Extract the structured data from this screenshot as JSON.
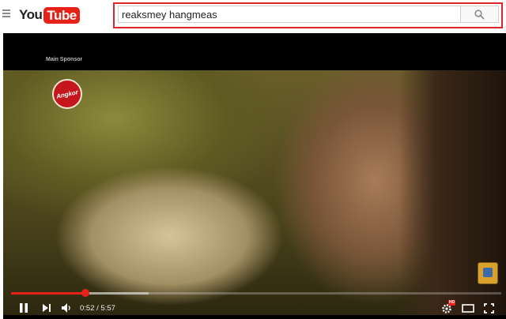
{
  "header": {
    "logo_you": "You",
    "logo_tube": "Tube",
    "search": {
      "value": "reaksmey hangmeas",
      "placeholder": ""
    }
  },
  "video": {
    "sponsor_label": "Main Sponsor",
    "logo_text": "Angkor",
    "progress": {
      "played_fraction": 0.152,
      "buffered_fraction": 0.28
    },
    "time": {
      "current": "0:52",
      "separator": " / ",
      "duration": "5:57"
    },
    "icons": {
      "play_pause": "pause-icon",
      "next": "next-icon",
      "volume": "volume-icon",
      "settings": "settings-icon",
      "theater": "theater-mode-icon",
      "fullscreen": "fullscreen-icon"
    },
    "hd_badge": "HD"
  },
  "colors": {
    "accent": "#e62117",
    "highlight_box": "#e0242b"
  }
}
